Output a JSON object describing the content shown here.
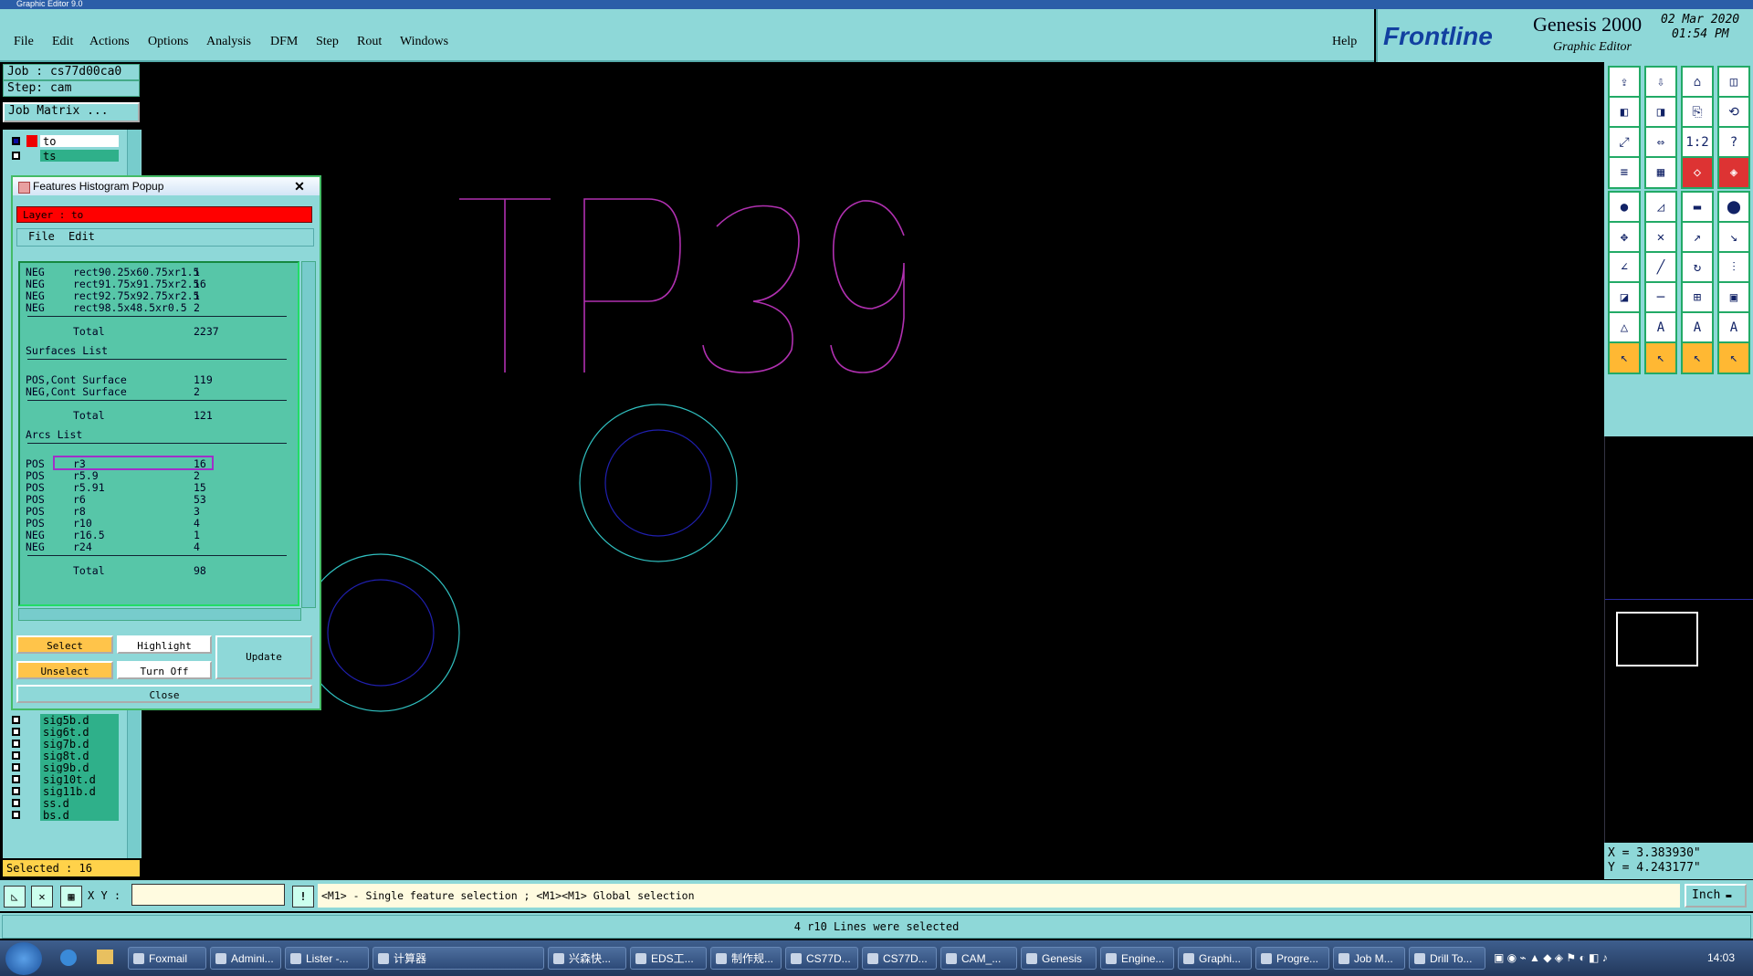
{
  "window": {
    "title": "Graphic Editor 9.0"
  },
  "menu": [
    "File",
    "Edit",
    "Actions",
    "Options",
    "Analysis",
    "DFM",
    "Step",
    "Rout",
    "Windows"
  ],
  "help": "Help",
  "brand": {
    "logo": "Frontline",
    "product": "Genesis 2000",
    "subtitle": "Graphic Editor",
    "date": "02 Mar 2020",
    "time": "01:54 PM"
  },
  "job": {
    "job_line": "Job : cs77d00ca0",
    "step_line": "Step: cam",
    "matrix_button": "Job Matrix ..."
  },
  "layers_top": [
    "to",
    "ts"
  ],
  "layers_bottom": [
    "sig5b.d",
    "sig6t.d",
    "sig7b.d",
    "sig8t.d",
    "sig9b.d",
    "sig10t.d",
    "sig11b.d",
    "ss.d",
    "bs.d"
  ],
  "selected": "Selected : 16",
  "popup": {
    "title": "Features Histogram Popup",
    "layer": "Layer :  to",
    "menu": [
      "File",
      "Edit"
    ],
    "rows_top": [
      {
        "pol": "NEG",
        "sym": "rect90.25x60.75xr1.5",
        "count": "1"
      },
      {
        "pol": "NEG",
        "sym": "rect91.75x91.75xr2.5",
        "count": "16"
      },
      {
        "pol": "NEG",
        "sym": "rect92.75x92.75xr2.5",
        "count": "1"
      },
      {
        "pol": "NEG",
        "sym": "rect98.5x48.5xr0.5",
        "count": "2"
      }
    ],
    "total1_label": "Total",
    "total1": "2237",
    "surfaces_title": "Surfaces List",
    "surfaces": [
      {
        "pol": "POS,Cont Surface",
        "count": "119"
      },
      {
        "pol": "NEG,Cont Surface",
        "count": "2"
      }
    ],
    "total2_label": "Total",
    "total2": "121",
    "arcs_title": "Arcs List",
    "arcs": [
      {
        "pol": "POS",
        "sym": "r3",
        "count": "16"
      },
      {
        "pol": "POS",
        "sym": "r5.9",
        "count": "2"
      },
      {
        "pol": "POS",
        "sym": "r5.91",
        "count": "15"
      },
      {
        "pol": "POS",
        "sym": "r6",
        "count": "53"
      },
      {
        "pol": "POS",
        "sym": "r8",
        "count": "3"
      },
      {
        "pol": "POS",
        "sym": "r10",
        "count": "4"
      },
      {
        "pol": "NEG",
        "sym": "r16.5",
        "count": "1"
      },
      {
        "pol": "NEG",
        "sym": "r24",
        "count": "4"
      }
    ],
    "total3_label": "Total",
    "total3": "98",
    "buttons": {
      "select": "Select",
      "highlight": "Highlight",
      "update": "Update",
      "unselect": "Unselect",
      "turn_off": "Turn Off",
      "close": "Close"
    }
  },
  "canvas": {
    "text": "TP39",
    "text_color": "#b030b0"
  },
  "coords": {
    "x": "X = 3.383930\"",
    "y": "Y = 4.243177\""
  },
  "cmd": {
    "xy_label": "X Y :",
    "hint": "<M1> - Single feature selection ; <M1><M1> Global selection",
    "units": "Inch"
  },
  "message": "4 r10 Lines were selected",
  "taskbar": [
    "Foxmail",
    "Admini...",
    "Lister -...",
    "计算器",
    "兴森快...",
    "EDS工...",
    "制作规...",
    "CS77D...",
    "CS77D...",
    "CAM_...",
    "Genesis",
    "Engine...",
    "Graphi...",
    "Progre...",
    "Job M...",
    "Drill To..."
  ],
  "clock": "14:03"
}
